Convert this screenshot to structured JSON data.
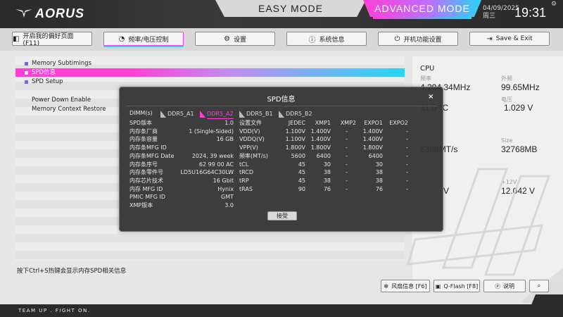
{
  "header": {
    "logo": "AORUS",
    "easy_mode": "EASY MODE",
    "advanced_mode": "ADVANCED MODE",
    "date": "04/09/2025",
    "weekday": "周三",
    "time": "19:31"
  },
  "nav": [
    {
      "label": "开启我的偏好页面 (F11)",
      "icon": "favorites-icon"
    },
    {
      "label": "频率/电压控制",
      "icon": "speedometer-icon"
    },
    {
      "label": "设置",
      "icon": "gear-icon"
    },
    {
      "label": "系统信息",
      "icon": "info-icon"
    },
    {
      "label": "开机功能设置",
      "icon": "power-icon"
    },
    {
      "label": "Save & Exit",
      "icon": "exit-icon"
    }
  ],
  "menu": {
    "items": [
      {
        "label": "Memory Subtimings",
        "bullet": true
      },
      {
        "label": "SPD信息",
        "bullet": true,
        "selected": true
      },
      {
        "label": "SPD Setup",
        "bullet": true
      },
      {
        "label": "",
        "bullet": false
      },
      {
        "label": "Power Down Enable",
        "bullet": false
      },
      {
        "label": "Memory Context Restore",
        "bullet": false
      }
    ]
  },
  "right_panel": {
    "cpu_title": "CPU",
    "freq_label": "频率",
    "freq_value": "4,204.34MHz",
    "ext_label": "外频",
    "ext_value": "99.65MHz",
    "temp_value": "31.0 °C",
    "volt_label": "电压",
    "volt_value": "1.029 V",
    "mem_speed_value": "6398MT/s",
    "size_label": "Size",
    "size_value": "32768MB",
    "v12_label": "+12V",
    "v12_value": "12.042 V",
    "partial_v": "V"
  },
  "hint": "按下Ctrl+S热键会显示内存SPD相关信息",
  "bottom_buttons": [
    {
      "label": "风扇信息 [F6]",
      "icon": "fan-icon"
    },
    {
      "label": "Q-Flash [F8]",
      "icon": "chip-icon"
    },
    {
      "label": "说明",
      "icon": "help-icon"
    },
    {
      "label": "",
      "icon": "search-icon"
    }
  ],
  "footer": "TEAM UP . FIGHT ON.",
  "dialog": {
    "title": "SPD信息",
    "close": "×",
    "dimm_label": "DIMM(s)",
    "dimm_tabs": [
      {
        "label": "DDR5_A1",
        "active": false
      },
      {
        "label": "DDR5_A2",
        "active": true
      },
      {
        "label": "DDR5_B1",
        "active": false
      },
      {
        "label": "DDR5_B2",
        "active": false
      }
    ],
    "info": [
      {
        "k": "SPD版本",
        "v": "1.0"
      },
      {
        "k": "内存条厂商",
        "v": "1 (Single-Sided)"
      },
      {
        "k": "内存条容量",
        "v": "16 GB"
      },
      {
        "k": "内存条MFG ID",
        "v": ""
      },
      {
        "k": "内存条MFG Date",
        "v": "2024, 39 week"
      },
      {
        "k": "内存条序号",
        "v": "62 99 00 AC"
      },
      {
        "k": "内存条零件号",
        "v": "LD5U16G64C30LW"
      },
      {
        "k": "内存芯片技术",
        "v": "16 Gbit"
      },
      {
        "k": "内存 MFG ID",
        "v": "Hynix"
      },
      {
        "k": "PMIC MFG ID",
        "v": "GMT"
      },
      {
        "k": "XMP版本",
        "v": "3.0"
      }
    ],
    "table": {
      "headers": [
        "设置文件",
        "JEDEC",
        "XMP1",
        "XMP2",
        "EXPO1",
        "EXPO2"
      ],
      "rows": [
        [
          "VDD(V)",
          "1.100V",
          "1.400V",
          "-",
          "1.400V",
          "-"
        ],
        [
          "VDDQ(V)",
          "1.100V",
          "1.400V",
          "-",
          "1.400V",
          "-"
        ],
        [
          "VPP(V)",
          "1.800V",
          "1.800V",
          "-",
          "1.800V",
          "-"
        ],
        [
          "频率(MT/s)",
          "5600",
          "6400",
          "-",
          "6400",
          "-"
        ],
        [
          "tCL",
          "45",
          "30",
          "-",
          "30",
          "-"
        ],
        [
          "tRCD",
          "45",
          "38",
          "-",
          "38",
          "-"
        ],
        [
          "tRP",
          "45",
          "38",
          "-",
          "38",
          "-"
        ],
        [
          "tRAS",
          "90",
          "76",
          "-",
          "76",
          "-"
        ]
      ]
    },
    "accept": "接受"
  }
}
